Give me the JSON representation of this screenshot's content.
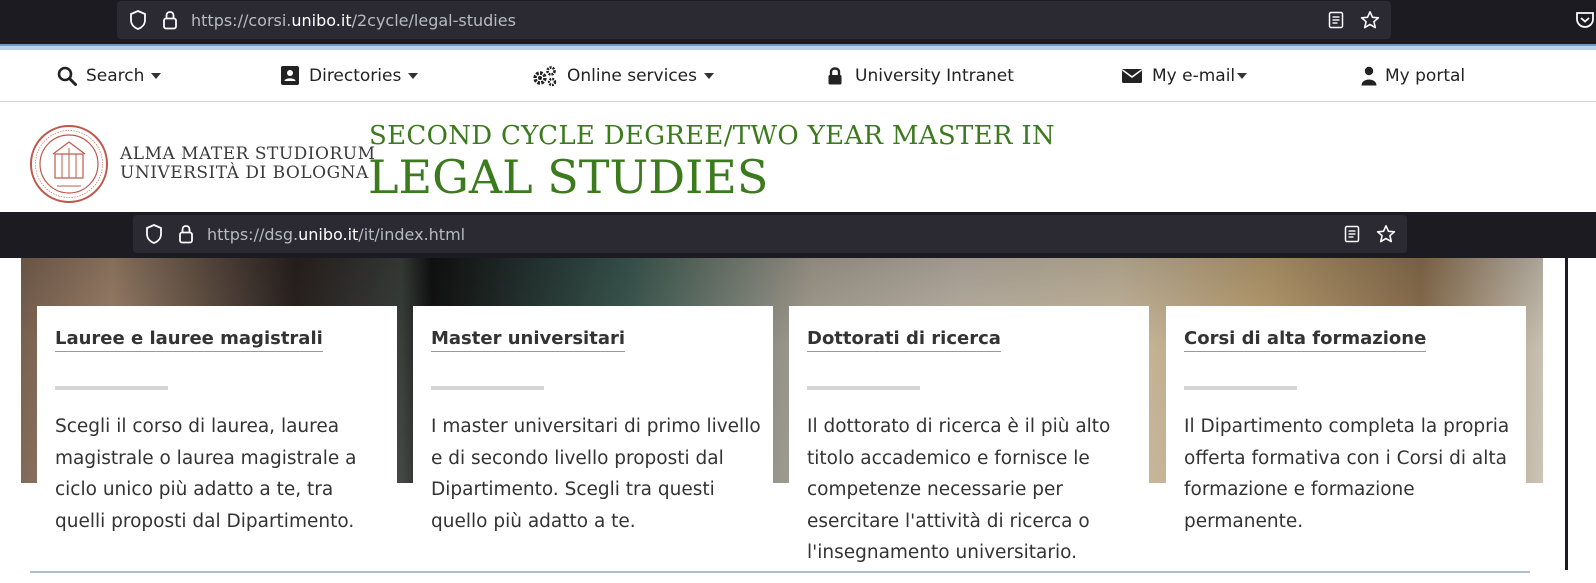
{
  "browser_top": {
    "url_prefix": "https://corsi.",
    "url_domain": "unibo.it",
    "url_path": "/2cycle/legal-studies"
  },
  "browser_mid": {
    "url_prefix": "https://dsg.",
    "url_domain": "unibo.it",
    "url_path": "/it/index.html"
  },
  "uninav": {
    "search": "Search",
    "directories": "Directories",
    "online_services": "Online services",
    "intranet": "University Intranet",
    "email": "My e-mail",
    "portal": "My portal"
  },
  "header": {
    "alma_line1": "ALMA MATER STUDIORUM",
    "alma_line2": "UNIVERSITÀ DI BOLOGNA",
    "degree_line": "SECOND CYCLE DEGREE/TWO YEAR MASTER IN",
    "course_title": "LEGAL STUDIES"
  },
  "cards": [
    {
      "title": "Lauree e lauree magistrali",
      "text": "Scegli il corso di laurea, laurea magistrale o laurea magistrale a ciclo unico più adatto a te, tra quelli proposti dal Dipartimento."
    },
    {
      "title": "Master universitari",
      "text": "I master universitari di primo livello e di secondo livello proposti dal Dipartimento. Scegli tra questi quello più adatto a te."
    },
    {
      "title": "Dottorati di ricerca",
      "text": "Il dottorato di ricerca è il più alto titolo accademico e fornisce le competenze necessarie per esercitare l'attività di ricerca o l'insegnamento universitario."
    },
    {
      "title": "Corsi di alta formazione",
      "text": "Il Dipartimento completa la propria offerta formativa con i Corsi di alta formazione e formazione permanente."
    }
  ],
  "colors": {
    "green": "#3c7a1e",
    "seal_red": "#c0584a",
    "browser_dark": "#1c1b22"
  }
}
